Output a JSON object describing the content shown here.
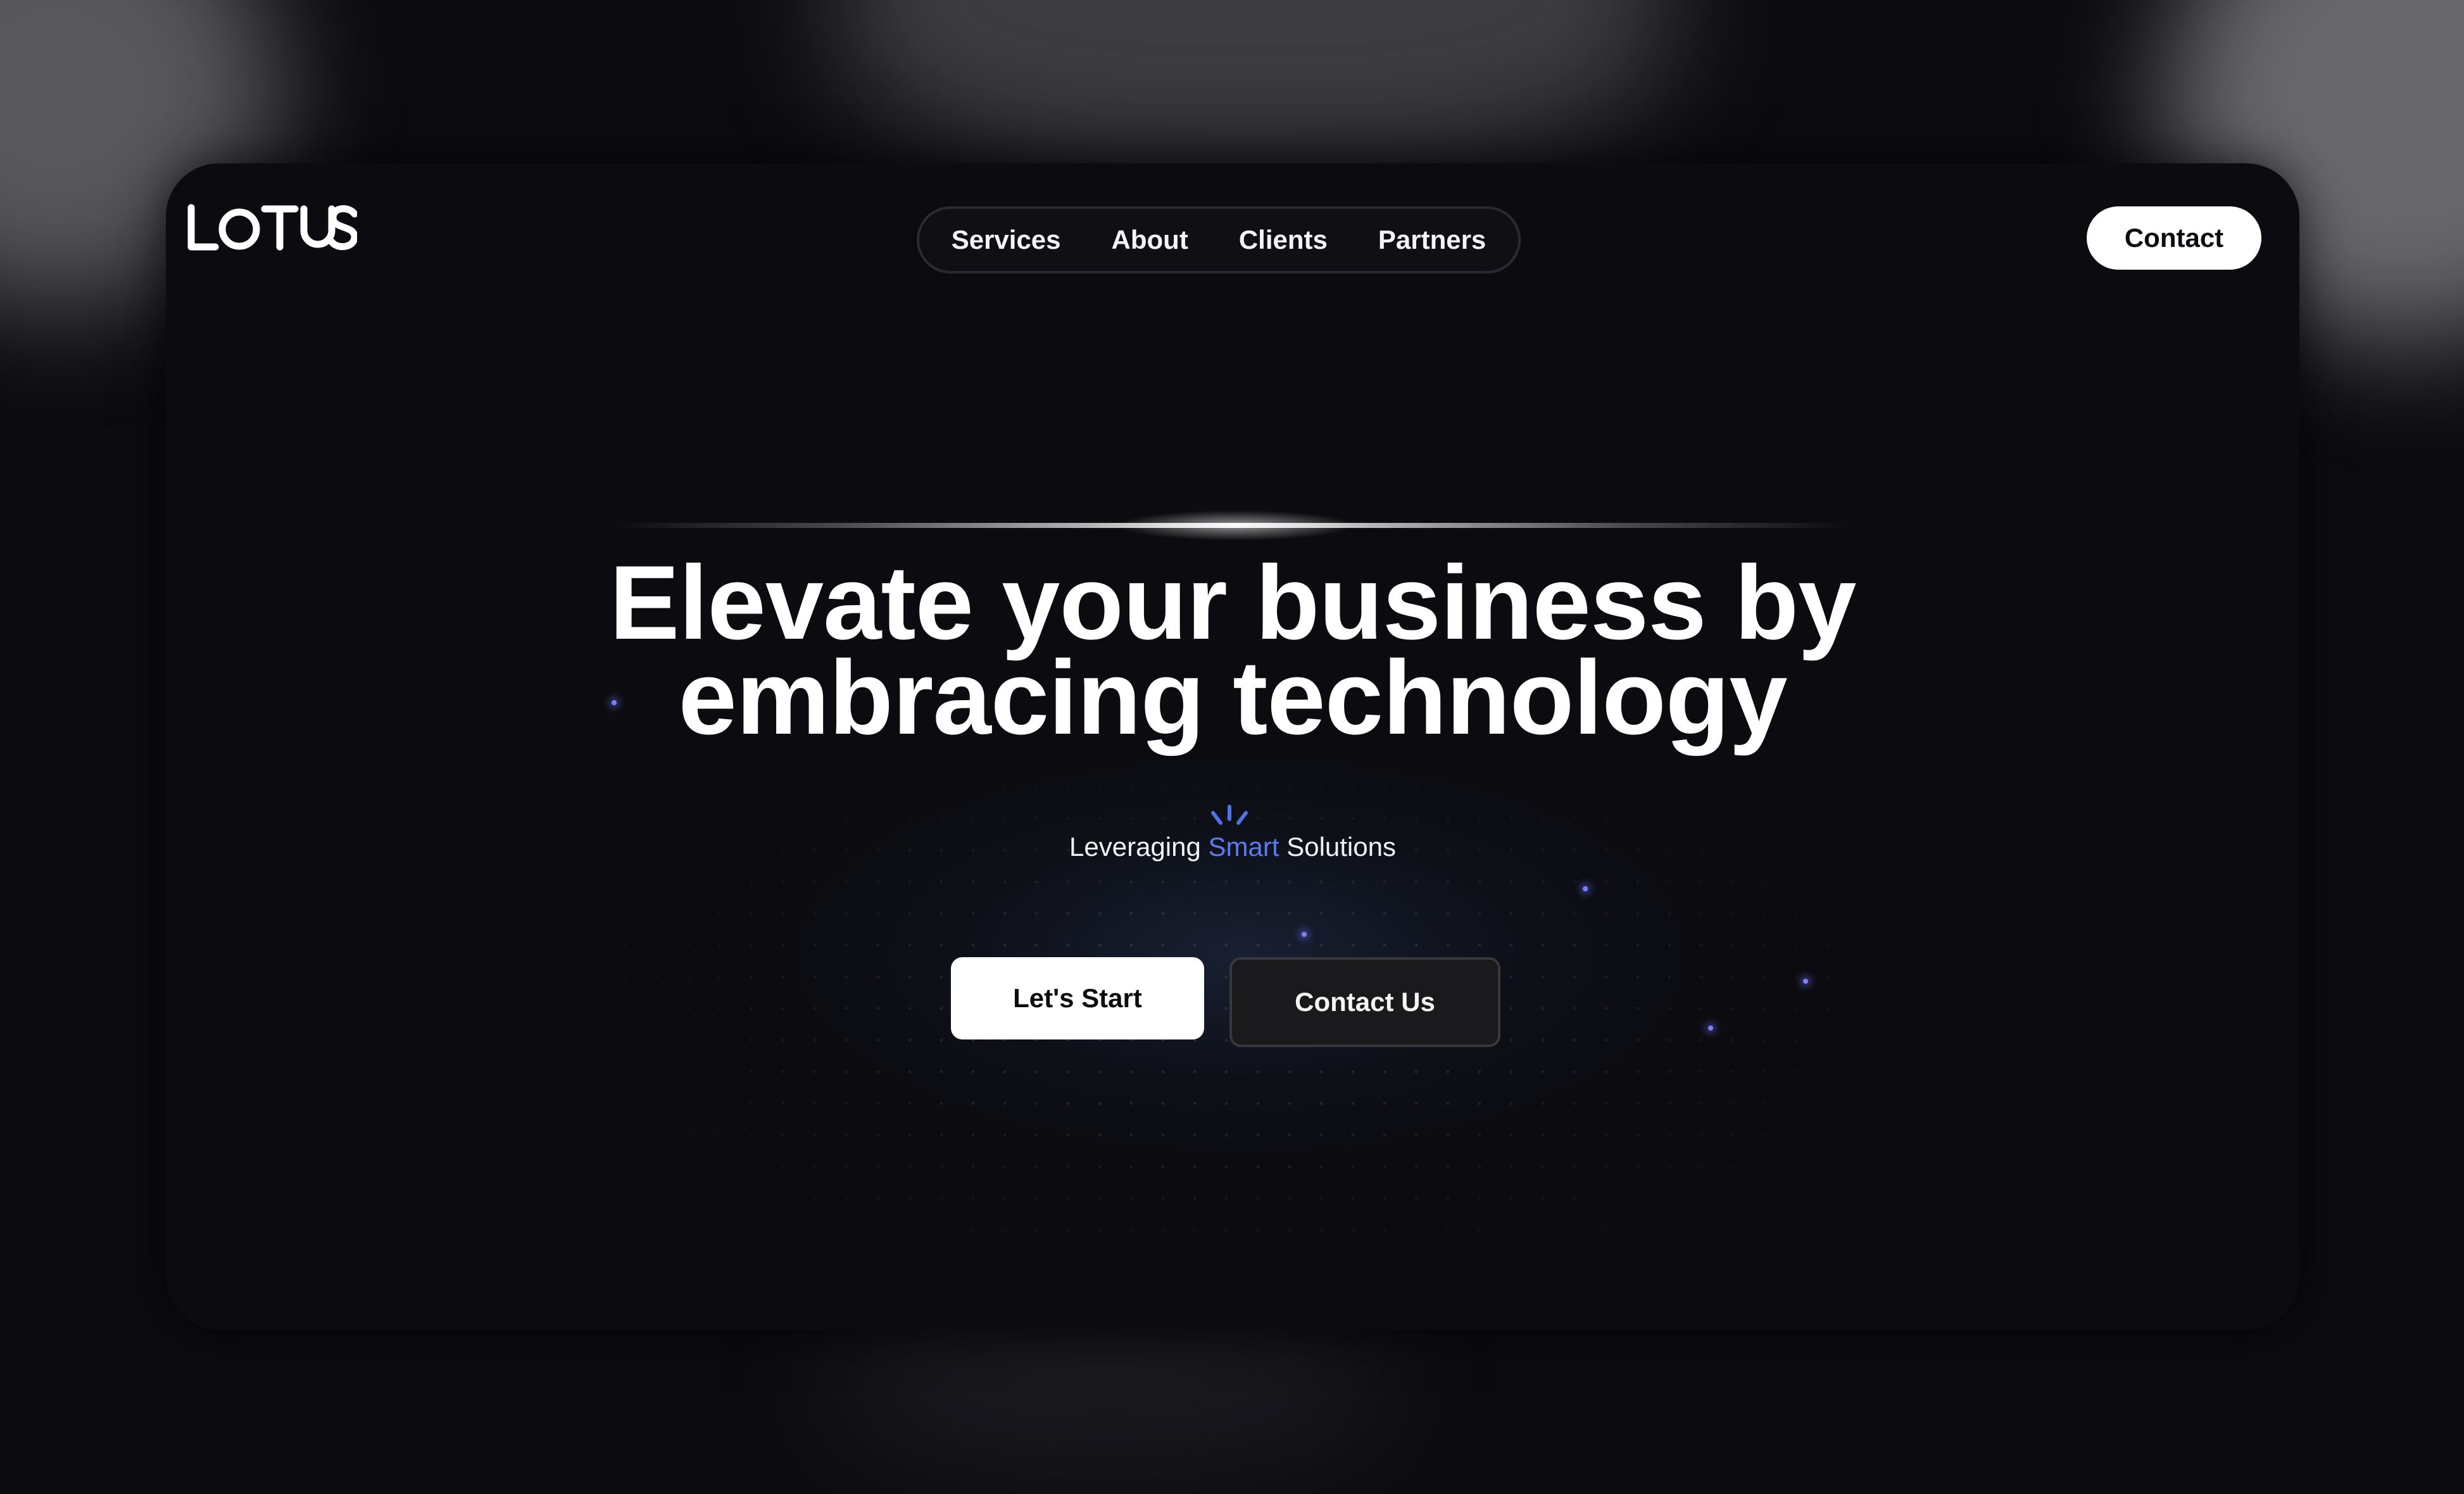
{
  "brand": {
    "logo_text": "LOTUS"
  },
  "nav": {
    "items": [
      {
        "label": "Services"
      },
      {
        "label": "About"
      },
      {
        "label": "Clients"
      },
      {
        "label": "Partners"
      }
    ]
  },
  "header": {
    "contact_label": "Contact"
  },
  "hero": {
    "headline_line1": "Elevate your business by",
    "headline_line2": "embracing technology",
    "subtitle_before": "Leveraging",
    "subtitle_accent": "Smart",
    "subtitle_after": "Solutions",
    "primary_button": "Let's Start",
    "secondary_button": "Contact Us"
  },
  "colors": {
    "background": "#0c0c10",
    "accent": "#5b7cf0",
    "spark": "#7c80ff",
    "button_primary_bg": "#ffffff",
    "button_secondary_bg": "#1a1a1d"
  },
  "icons": {
    "subtitle_icon": "spark-rays-icon"
  }
}
